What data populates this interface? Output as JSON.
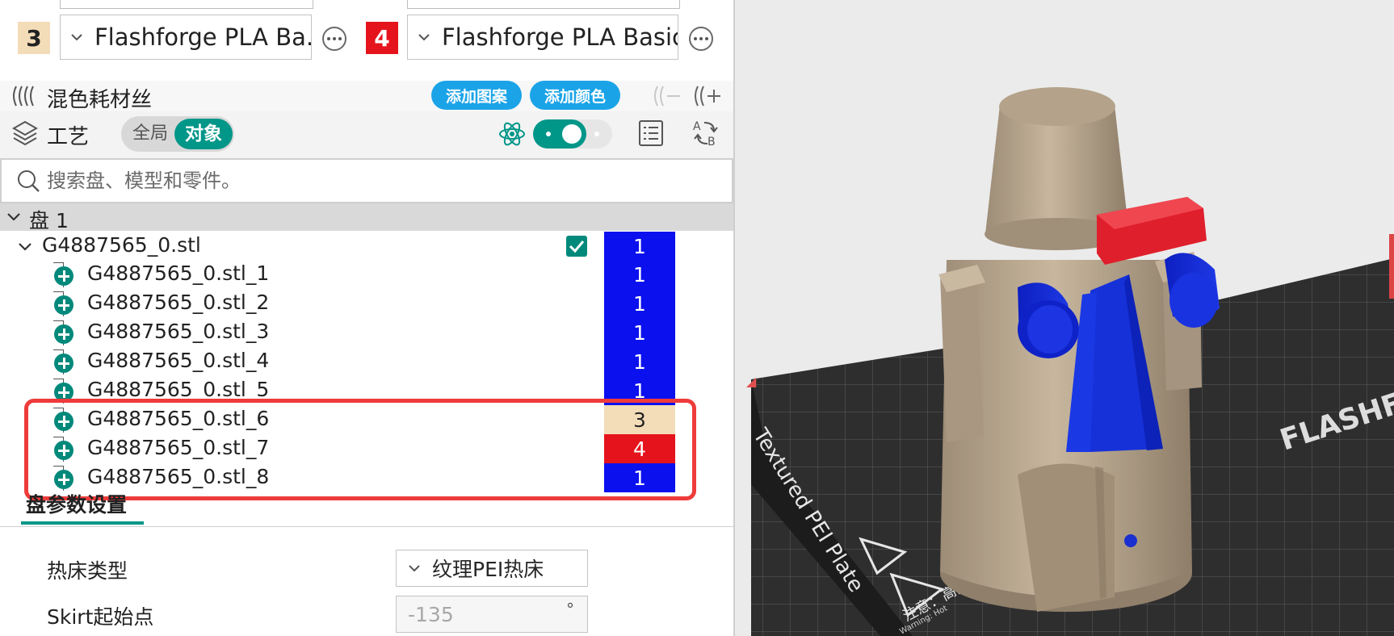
{
  "filaments": [
    {
      "num": "3",
      "num_bg": "#f3dcb8",
      "num_color": "#222222",
      "name": "Flashforge PLA Ba..."
    },
    {
      "num": "4",
      "num_bg": "#e5141c",
      "num_color": "#ffffff",
      "name": "Flashforge PLA Basic"
    }
  ],
  "mix": {
    "title": "混色耗材丝",
    "add_pattern": "添加图案",
    "add_color": "添加颜色"
  },
  "process": {
    "title": "工艺",
    "global": "全局",
    "object": "对象"
  },
  "search": {
    "placeholder": "搜索盘、模型和零件。"
  },
  "tree": {
    "plate": "盘 1",
    "object": {
      "name": "G4887565_0.stl",
      "extruder": "1",
      "checked": true
    },
    "parts": [
      {
        "name": "G4887565_0.stl_1",
        "extruder": "1",
        "color": "#0a10ee"
      },
      {
        "name": "G4887565_0.stl_2",
        "extruder": "1",
        "color": "#0a10ee"
      },
      {
        "name": "G4887565_0.stl_3",
        "extruder": "1",
        "color": "#0a10ee"
      },
      {
        "name": "G4887565_0.stl_4",
        "extruder": "1",
        "color": "#0a10ee"
      },
      {
        "name": "G4887565_0.stl_5",
        "extruder": "1",
        "color": "#0a10ee"
      },
      {
        "name": "G4887565_0.stl_6",
        "extruder": "3",
        "color": "#f3dcb8"
      },
      {
        "name": "G4887565_0.stl_7",
        "extruder": "4",
        "color": "#e5141c"
      },
      {
        "name": "G4887565_0.stl_8",
        "extruder": "1",
        "color": "#0a10ee"
      }
    ]
  },
  "plate_settings": {
    "tab": "盘参数设置",
    "bed_type_label": "热床类型",
    "bed_type_value": "纹理PEI热床",
    "skirt_label": "Skirt起始点",
    "skirt_value": "-135",
    "skirt_unit": "°"
  },
  "viewport": {
    "plate_label": "Textured PEI Plate",
    "brand_text": "FLASHFORGE",
    "warning_text": "注意：高温",
    "warning_sub": "Warning: Hot",
    "model_colors": {
      "body": "#b7a48c",
      "band": "#d01d2a",
      "accent": "#1a2fd0",
      "bed": "#2d2d2d"
    }
  }
}
